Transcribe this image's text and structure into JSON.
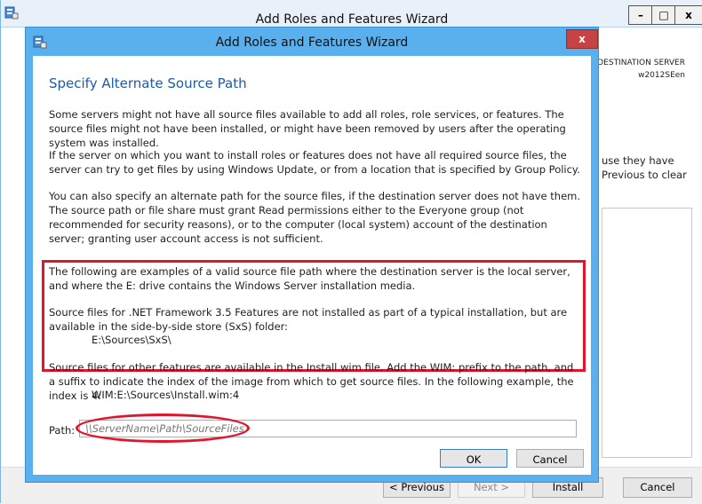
{
  "background_window": {
    "title": "Add Roles and Features Wizard",
    "min_label": "–",
    "max_label": "□",
    "close_label": "x",
    "destination_label": "DESTINATION SERVER",
    "destination_server": "w2012SEen",
    "partial_text_1": "use they have",
    "partial_text_2": "Previous to clear",
    "buttons": {
      "previous": "< Previous",
      "next": "Next >",
      "install": "Install",
      "cancel": "Cancel"
    }
  },
  "dialog": {
    "title": "Add Roles and Features Wizard",
    "close_label": "x",
    "heading": "Specify Alternate Source Path",
    "paragraph_1": "Some servers might not have all source files available to add all roles, role services, or features. The source files might not have been installed, or might have been removed by users after the operating system was installed.",
    "paragraph_2": "If the server on which you want to install roles or features does not have all required source files, the server can try to get files by using Windows Update, or from a location that is specified by Group Policy.",
    "paragraph_3": "You can also specify an alternate path for the source files, if the destination server does not have them. The source path or file share must grant Read permissions either to the Everyone group (not recommended for security reasons), or to the computer (local system) account of the destination server; granting user account access is not sufficient.",
    "paragraph_4": "The following are examples of a valid source file path where the destination server is the local server, and where the E: drive contains the Windows Server installation media.",
    "paragraph_5": "Source files for .NET Framework 3.5 Features are not installed as part of a typical installation, but are available in the side-by-side store (SxS) folder:",
    "sxs_path": "E:\\Sources\\SxS\\",
    "paragraph_6": "Source files for other features are available in the Install.wim file. Add the WIM: prefix to the path, and a suffix to indicate the index of the image from which to get source files. In the following example, the index is 4:",
    "wim_path": "WIM:E:\\Sources\\Install.wim:4",
    "path_label": "Path:",
    "path_placeholder": "\\\\ServerName\\Path\\SourceFiles",
    "ok_label": "OK",
    "cancel_label": "Cancel"
  },
  "colors": {
    "dialog_frame": "#5ab0ec",
    "heading": "#1e5aa8",
    "highlight": "#e0162e",
    "close_button": "#c74343"
  }
}
